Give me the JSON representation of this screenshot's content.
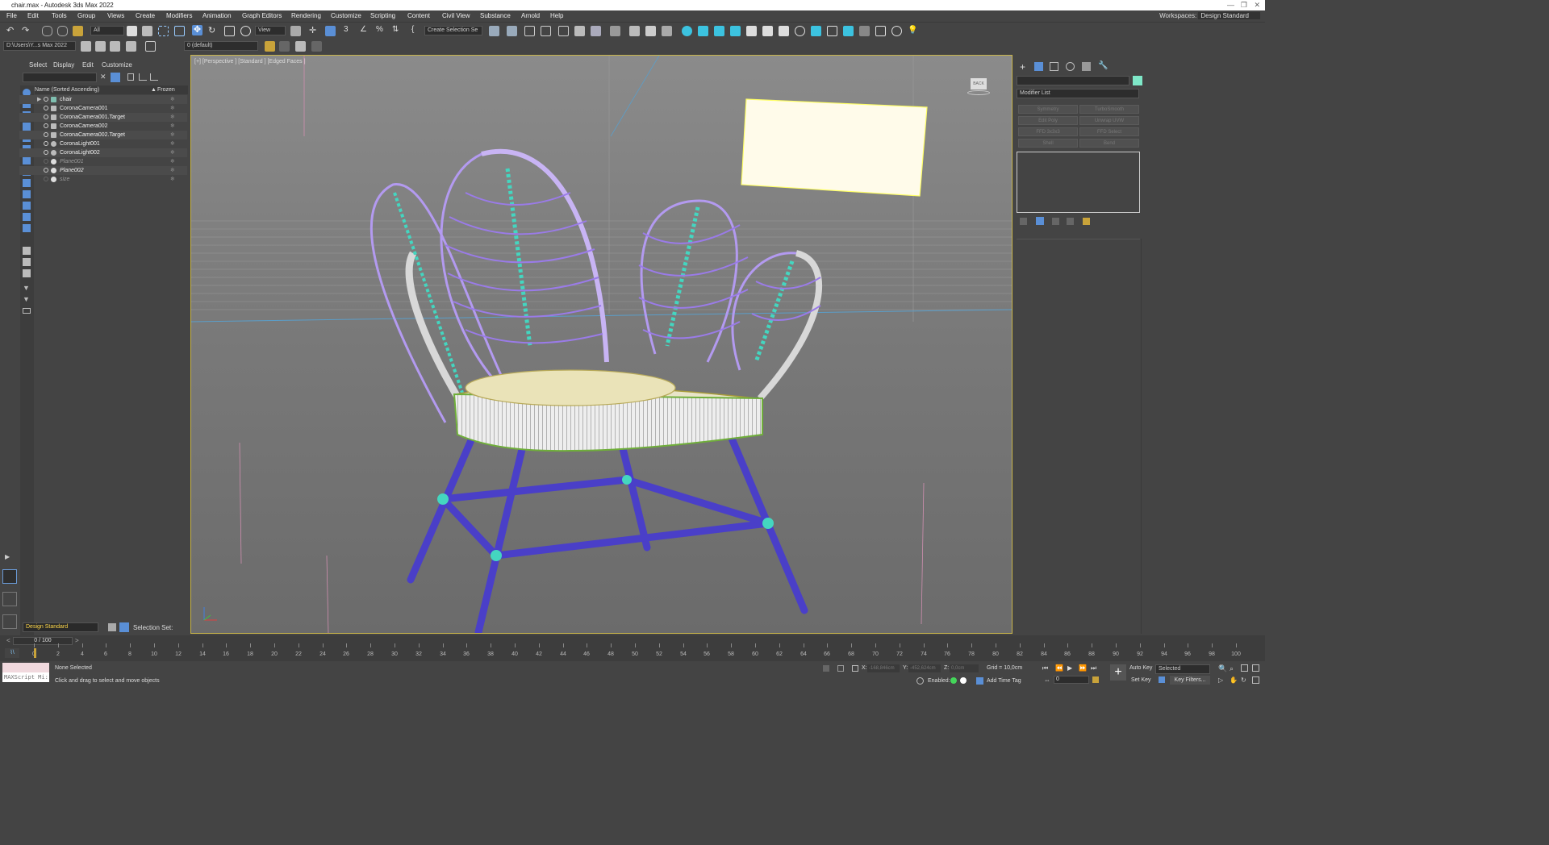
{
  "title": "chair.max - Autodesk 3ds Max 2022",
  "menu": [
    "File",
    "Edit",
    "Tools",
    "Group",
    "Views",
    "Create",
    "Modifiers",
    "Animation",
    "Graph Editors",
    "Rendering",
    "Customize",
    "Scripting",
    "Content",
    "Civil View",
    "Substance",
    "Arnold",
    "Help"
  ],
  "workspace_label": "Workspaces:",
  "workspace_value": "Design Standard",
  "toolbar": {
    "filter": "All",
    "view": "View",
    "selection_set": "Create Selection Se",
    "project_path": "D:\\Users\\Y...s Max 2022",
    "layer": "0 (default)"
  },
  "scene_explorer": {
    "tabs": [
      "Select",
      "Display",
      "Edit",
      "Customize"
    ],
    "column_name": "Name (Sorted Ascending)",
    "column_frozen": "Frozen",
    "rows": [
      {
        "name": "chair",
        "italic": false
      },
      {
        "name": "CoronaCamera001",
        "italic": false
      },
      {
        "name": "CoronaCamera001.Target",
        "italic": false
      },
      {
        "name": "CoronaCamera002",
        "italic": false
      },
      {
        "name": "CoronaCamera002.Target",
        "italic": false
      },
      {
        "name": "CoronaLight001",
        "italic": false
      },
      {
        "name": "CoronaLight002",
        "italic": false
      },
      {
        "name": "Plane001",
        "italic": true
      },
      {
        "name": "Plane002",
        "italic": true
      },
      {
        "name": "size",
        "italic": true
      }
    ],
    "workspace": "Design Standard",
    "selection_set_label": "Selection Set:"
  },
  "viewport": {
    "label": "[+] [Perspective ] [Standard ] [Edged Faces ]",
    "viewcube": "BACK"
  },
  "command_panel": {
    "modifier_list": "Modifier List",
    "modifiers": [
      "Symmetry",
      "TurboSmooth",
      "Edit Poly",
      "Unwrap UVW",
      "FFD 3x3x3",
      "FFD Select",
      "Shell",
      "Bend"
    ],
    "color": "#7fe8c8"
  },
  "timeline": {
    "frame": "0 / 100",
    "ticks": [
      "0",
      "2",
      "4",
      "6",
      "8",
      "10",
      "12",
      "14",
      "16",
      "18",
      "20",
      "22",
      "24",
      "26",
      "28",
      "30",
      "32",
      "34",
      "36",
      "38",
      "40",
      "42",
      "44",
      "46",
      "48",
      "50",
      "52",
      "54",
      "56",
      "58",
      "60",
      "62",
      "64",
      "66",
      "68",
      "70",
      "72",
      "74",
      "76",
      "78",
      "80",
      "82",
      "84",
      "86",
      "88",
      "90",
      "92",
      "94",
      "96",
      "98",
      "100"
    ]
  },
  "status": {
    "maxscript": "MAXScript Mi:",
    "selection": "None Selected",
    "prompt": "Click and drag to select and move objects",
    "x_label": "X:",
    "x": "-168,846cm",
    "y_label": "Y:",
    "y": "-452,624cm",
    "z_label": "Z:",
    "z": "0,0cm",
    "grid": "Grid = 10,0cm",
    "enabled": "Enabled:",
    "add_time_tag": "Add Time Tag",
    "auto_key": "Auto Key",
    "selected": "Selected",
    "set_key": "Set Key",
    "key_filters": "Key Filters...",
    "frame_field": "0"
  }
}
